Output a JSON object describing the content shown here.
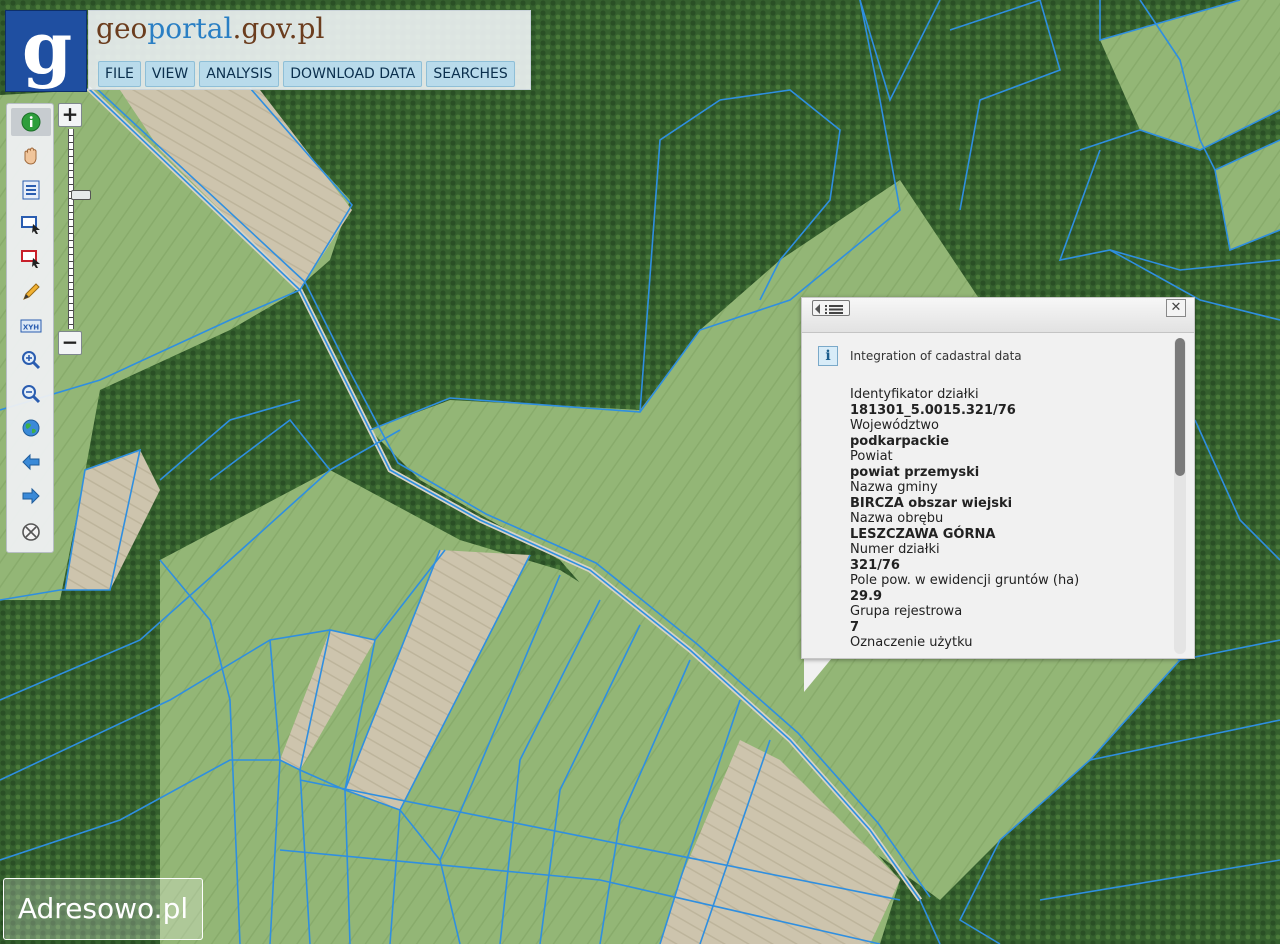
{
  "brand": {
    "prefix": "g",
    "portal_a": "eo",
    "portal_b": "portal",
    "domain": ".gov.pl"
  },
  "menu": [
    {
      "label": "FILE"
    },
    {
      "label": "VIEW"
    },
    {
      "label": "ANALYSIS"
    },
    {
      "label": "DOWNLOAD DATA"
    },
    {
      "label": "SEARCHES"
    }
  ],
  "toolbar": {
    "tools": [
      {
        "name": "info-icon",
        "color": "#2e9e3c"
      },
      {
        "name": "pan-hand-icon",
        "color": "#d9a06a"
      },
      {
        "name": "legend-list-icon",
        "color": "#2a5db0"
      },
      {
        "name": "select-rectangle-blue-icon",
        "color": "#2a5db0"
      },
      {
        "name": "select-rectangle-red-icon",
        "color": "#c8202a"
      },
      {
        "name": "pencil-icon",
        "color": "#e0a020"
      },
      {
        "name": "xyh-coordinates-icon",
        "color": "#2a5db0"
      },
      {
        "name": "zoom-in-icon",
        "color": "#2a5db0"
      },
      {
        "name": "zoom-out-icon",
        "color": "#2a5db0"
      },
      {
        "name": "globe-icon",
        "color": "#2e9e3c"
      },
      {
        "name": "arrow-left-icon",
        "color": "#3a8ad8"
      },
      {
        "name": "arrow-right-icon",
        "color": "#3a8ad8"
      },
      {
        "name": "clear-icon",
        "color": "#555555"
      }
    ],
    "xyh_label": "XYH",
    "zoom_level": 0.32,
    "zoom_plus": "+",
    "zoom_minus": "−"
  },
  "popup": {
    "title": "Integration of cadastral data",
    "info_glyph": "i",
    "close_glyph": "✕",
    "fields": [
      {
        "label": "Identyfikator działki",
        "value": "181301_5.0015.321/76"
      },
      {
        "label": "Województwo",
        "value": "podkarpackie"
      },
      {
        "label": "Powiat",
        "value": "powiat przemyski"
      },
      {
        "label": "Nazwa gminy",
        "value": "BIRCZA obszar wiejski"
      },
      {
        "label": "Nazwa obrębu",
        "value": "LESZCZAWA GÓRNA"
      },
      {
        "label": "Numer działki",
        "value": "321/76"
      },
      {
        "label": "Pole pow. w ewidencji gruntów (ha)",
        "value": "29.9"
      },
      {
        "label": "Grupa rejestrowa",
        "value": "7"
      },
      {
        "label": "Oznaczenie użytku",
        "value": ""
      }
    ],
    "scroll_fraction": 0.0
  },
  "watermark": {
    "text": "Adresowo.pl"
  },
  "colors": {
    "parcel_line": "#2f8fe0",
    "forest": "#2f5a2a",
    "field": "#8fb36a",
    "bare_field": "#c9bfa8"
  }
}
